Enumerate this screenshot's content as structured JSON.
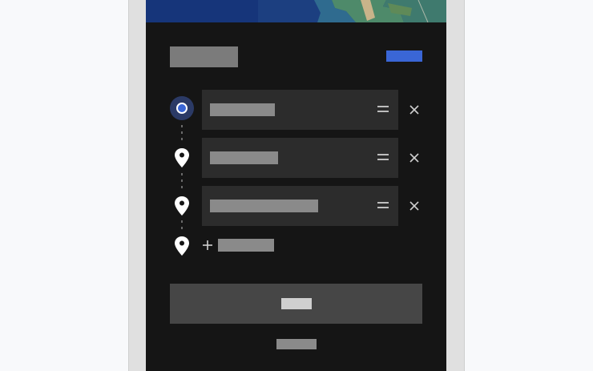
{
  "window": {
    "title": ""
  },
  "colors": {
    "background": "#151515",
    "field": "#2c2c2c",
    "accent": "#3a66d6",
    "primary_button": "#464646",
    "placeholder_bar": "#8a8a8a"
  },
  "header": {
    "title": "",
    "action_label": ""
  },
  "route": {
    "stops": [
      {
        "kind": "origin",
        "icon": "origin-dot-icon",
        "placeholder": ""
      },
      {
        "kind": "waypoint",
        "icon": "map-pin-icon",
        "placeholder": ""
      },
      {
        "kind": "destination",
        "icon": "map-pin-icon",
        "placeholder": ""
      }
    ],
    "add_stop_label": "",
    "add_icon": "plus-icon",
    "drag_icon": "drag-handle-icon",
    "remove_icon": "close-icon"
  },
  "footer": {
    "primary_label": "",
    "secondary_label": ""
  }
}
